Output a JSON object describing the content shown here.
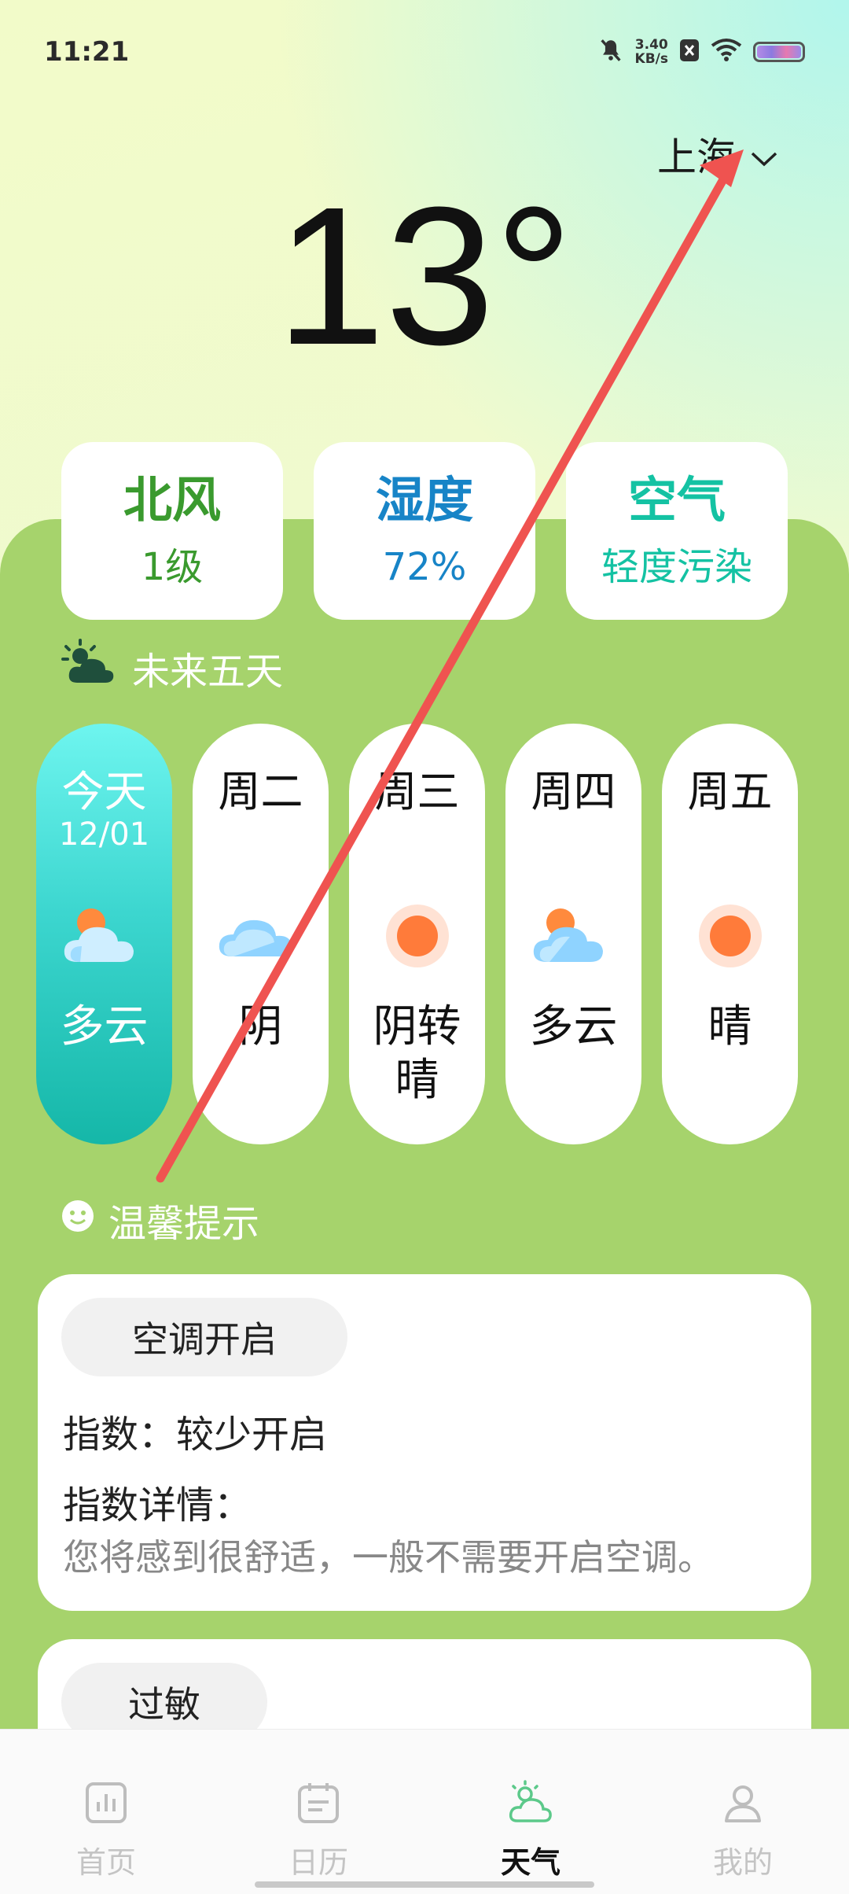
{
  "status_bar": {
    "time": "11:21",
    "network_speed_value": "3.40",
    "network_speed_unit": "KB/s"
  },
  "header": {
    "city": "上海",
    "temperature": "13°"
  },
  "metrics": [
    {
      "title": "北风",
      "value": "1级",
      "color": "#3a9a2e"
    },
    {
      "title": "湿度",
      "value": "72%",
      "color": "#1784c7"
    },
    {
      "title": "空气",
      "value": "轻度污染",
      "color": "#14c2a3"
    }
  ],
  "forecast_section": {
    "title": "未来五天"
  },
  "forecast": [
    {
      "day": "今天",
      "date": "12/01",
      "icon": "partly-cloudy-icon",
      "condition": "多云"
    },
    {
      "day": "周二",
      "date": "",
      "icon": "cloud-icon",
      "condition": "阴"
    },
    {
      "day": "周三",
      "date": "",
      "icon": "sun-icon",
      "condition": "阴转晴"
    },
    {
      "day": "周四",
      "date": "",
      "icon": "partly-cloudy-icon",
      "condition": "多云"
    },
    {
      "day": "周五",
      "date": "",
      "icon": "sun-icon",
      "condition": "晴"
    }
  ],
  "tips_section": {
    "title": "温馨提示"
  },
  "tips": [
    {
      "name": "空调开启",
      "index_label": "指数：",
      "index_value": "较少开启",
      "details_label": "指数详情：",
      "details": "您将感到很舒适，一般不需要开启空调。"
    },
    {
      "name": "过敏"
    }
  ],
  "nav": [
    {
      "label": "首页",
      "icon": "bar-chart-icon"
    },
    {
      "label": "日历",
      "icon": "calendar-icon"
    },
    {
      "label": "天气",
      "icon": "weather-icon",
      "active": true
    },
    {
      "label": "我的",
      "icon": "user-icon"
    }
  ],
  "colors": {
    "panel_green": "#a6d36c",
    "today_teal": "#3cd6cf",
    "active_nav": "#5cc98a",
    "arrow_red": "#ef5350"
  }
}
